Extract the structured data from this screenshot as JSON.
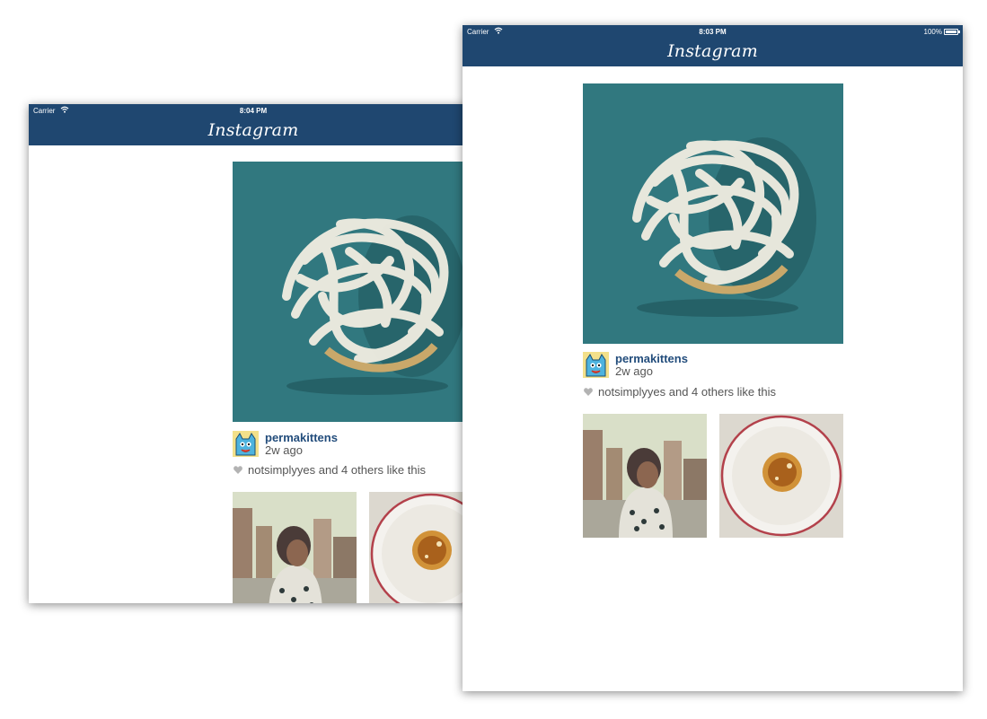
{
  "back_device": {
    "carrier": "Carrier",
    "time": "8:04 PM",
    "app_title": "Instagram",
    "post": {
      "username": "permakittens",
      "time_ago": "2w ago",
      "likes_text": "notsimplyyes and 4 others like this"
    }
  },
  "front_device": {
    "carrier": "Carrier",
    "time": "8:03 PM",
    "battery": "100%",
    "battery_level": 1.0,
    "app_title": "Instagram",
    "post": {
      "username": "permakittens",
      "time_ago": "2w ago",
      "likes_text": "notsimplyyes and 4 others like this"
    }
  },
  "colors": {
    "navbar": "#1f4770",
    "username": "#234d7c",
    "photo_background": "#2c6f76"
  },
  "icons": [
    "wifi-icon",
    "battery-icon",
    "heart-icon"
  ]
}
